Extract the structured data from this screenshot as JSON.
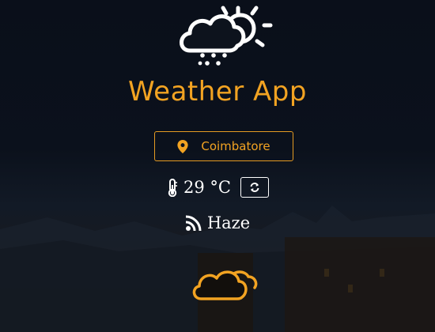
{
  "app": {
    "title": "Weather App",
    "accent_color": "#f2a322"
  },
  "location": {
    "icon": "map-marker-icon",
    "label": "Coimbatore"
  },
  "temperature": {
    "icon": "thermometer-icon",
    "value": "29 °C",
    "refresh_icon": "refresh-icon"
  },
  "condition": {
    "icon": "rss-feed-icon",
    "label": "Haze",
    "illustration": "cloud-outline-icon"
  },
  "logo": {
    "icon": "cloud-sun-rain-icon"
  }
}
